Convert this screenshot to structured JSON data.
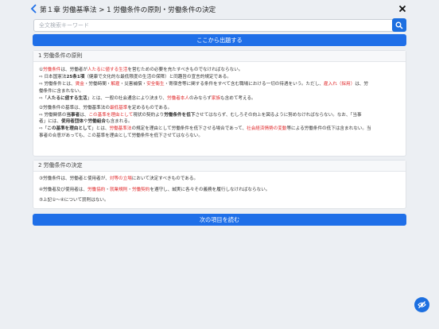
{
  "header": {
    "title": "第１章 労働基準法 > 1 労働条件の原則・労働条件の決定"
  },
  "search": {
    "placeholder": "全文検索キーワード"
  },
  "buttons": {
    "start_quiz": "ここから出題する",
    "next_item": "次の項目を読む"
  },
  "section1": {
    "heading": "1 労働条件の原則",
    "p1_marker": "①",
    "p1_a": "労働条件",
    "p1_b": "は、労働者が",
    "p1_c": "人たるに値する生活",
    "p1_d": "を営むための必要を充たすべきものでなければならない。",
    "p1_e": "⇨ 日本国憲法",
    "p1_f": "25条1項",
    "p1_g": "（健康で文化的な最低限度の生活の保障）と同趣旨の宣言的規定である。",
    "p1_h": "⇨ 労働条件とは、",
    "p1_i": "賃金",
    "p1_j": "・労働時間・",
    "p1_k": "解雇",
    "p1_l": "・災害補償・",
    "p1_m": "安全衛生",
    "p1_n": "・寄宿舎等に関する条件をすべて含む職場における一切の待遇をいう。ただし、",
    "p1_o": "雇入れ（採用）",
    "p1_p": "は、労",
    "p1_q": "働条件に含まれない。",
    "p1_r": "⇨「",
    "p1_s": "人たるに値する生活",
    "p1_t": "」とは、一般の社会通念により決まり、",
    "p1_u": "労働者本人",
    "p1_v": "のみならず",
    "p1_w": "家族",
    "p1_x": "も含めて考える。",
    "p2_marker": "②",
    "p2_a": "労働条件の基準は、労働基準法の",
    "p2_b": "最低基準",
    "p2_c": "を定めるものである。",
    "p2_d": "⇨ 労働関係の",
    "p2_e": "当事者",
    "p2_f": "は、",
    "p2_g": "この基準を理由として",
    "p2_h": "現状の契約より",
    "p2_i": "労働条件を低下",
    "p2_j": "させてはならず、むしろその向上を図るように努めなければならない。なお、「当事",
    "p2_k": "者」には、",
    "p2_l": "使用者団体",
    "p2_m": "や",
    "p2_n": "労働組合",
    "p2_o": "も含まれる。",
    "p2_p": "⇨「",
    "p2_q": "この基準を理由として",
    "p2_r": "」とは、",
    "p2_s": "労働基準法",
    "p2_t": "の規定を理由として労働条件を低下させる場合であって、",
    "p2_u": "社会経済情勢の変動",
    "p2_v": "等による労働条件の低下は含まれない。当",
    "p2_w": "事者の合意があっても、この基準を理由として労働条件を低下させてはならない。"
  },
  "section2": {
    "heading": "2 労働条件の決定",
    "l1_a": "③労働条件は、労働者と使用者が、",
    "l1_b": "対等の立場",
    "l1_c": "において決定すべきものである。",
    "l2_a": "④労働者及び使用者は、",
    "l2_b": "労働協約",
    "l2_c": "・",
    "l2_d": "就業規則",
    "l2_e": "・",
    "l2_f": "労働契約",
    "l2_g": "を遵守し、誠実に各々その義務を履行しなければならない。",
    "l3": "⑤上記①〜④について罰則はない。"
  },
  "icons": {
    "back": "chevron-left-icon",
    "close": "close-icon",
    "search": "search-icon",
    "toggle": "eye-slash-icon"
  },
  "colors": {
    "accent": "#1f6fe8",
    "highlight": "#e0282a",
    "background": "#eceff3"
  }
}
